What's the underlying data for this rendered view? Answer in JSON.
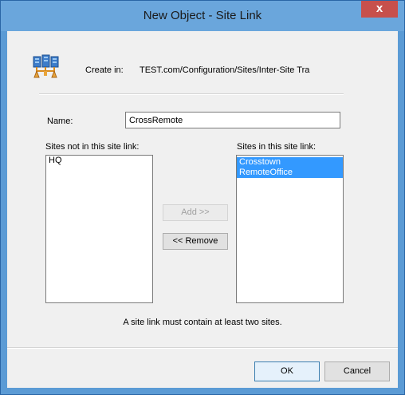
{
  "window": {
    "title": "New Object - Site Link",
    "close_glyph": "x"
  },
  "header": {
    "icon": "site-link-icon",
    "create_in_label": "Create in:",
    "create_in_path": "TEST.com/Configuration/Sites/Inter-Site Tra"
  },
  "name": {
    "label": "Name:",
    "value": "CrossRemote"
  },
  "sites_not_in": {
    "label": "Sites not in this site link:",
    "items": [
      "HQ"
    ]
  },
  "sites_in": {
    "label": "Sites in this site link:",
    "items": [
      "Crosstown",
      "RemoteOffice"
    ]
  },
  "buttons": {
    "add": "Add >>",
    "remove": "<< Remove",
    "ok": "OK",
    "cancel": "Cancel"
  },
  "note": "A site link must contain at least two sites.",
  "colors": {
    "titlebar": "#6aa6dc",
    "close_button": "#c7504c",
    "selection": "#3399ff",
    "dialog_bg": "#f0f0f0"
  }
}
